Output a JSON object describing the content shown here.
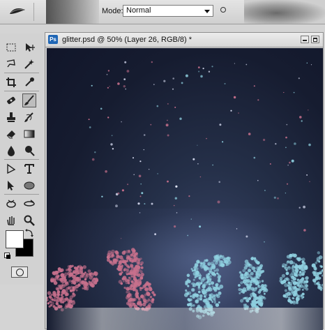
{
  "options_bar": {
    "mode_label": "Mode:",
    "mode_value": "Normal"
  },
  "document": {
    "app_icon": "Ps",
    "title": "glitter.psd @ 50% (Layer 26, RGB/8) *"
  },
  "toolbox": {
    "tools": [
      {
        "name": "rectangular-marquee-tool",
        "active": false
      },
      {
        "name": "move-tool",
        "active": false
      },
      {
        "name": "lasso-tool",
        "active": false
      },
      {
        "name": "magic-wand-tool",
        "active": false
      },
      {
        "name": "crop-tool",
        "active": false
      },
      {
        "name": "eyedropper-tool",
        "active": false
      },
      {
        "name": "spot-healing-brush-tool",
        "active": false
      },
      {
        "name": "brush-tool",
        "active": true
      },
      {
        "name": "clone-stamp-tool",
        "active": false
      },
      {
        "name": "history-brush-tool",
        "active": false
      },
      {
        "name": "eraser-tool",
        "active": false
      },
      {
        "name": "gradient-tool",
        "active": false
      },
      {
        "name": "blur-tool",
        "active": false
      },
      {
        "name": "dodge-tool",
        "active": false
      },
      {
        "name": "path-selection-tool",
        "active": false
      },
      {
        "name": "type-tool",
        "active": false
      },
      {
        "name": "direct-selection-tool",
        "active": false
      },
      {
        "name": "ellipse-tool",
        "active": false
      },
      {
        "name": "3d-rotate-tool",
        "active": false
      },
      {
        "name": "3d-orbit-tool",
        "active": false
      },
      {
        "name": "hand-tool",
        "active": false
      },
      {
        "name": "zoom-tool",
        "active": false
      }
    ],
    "foreground_color": "#ffffff",
    "background_color": "#000000"
  },
  "colors": {
    "canvas_dark": "#161c30",
    "glitter_pink": "#c7708c",
    "glitter_cyan": "#8fd0e0"
  }
}
